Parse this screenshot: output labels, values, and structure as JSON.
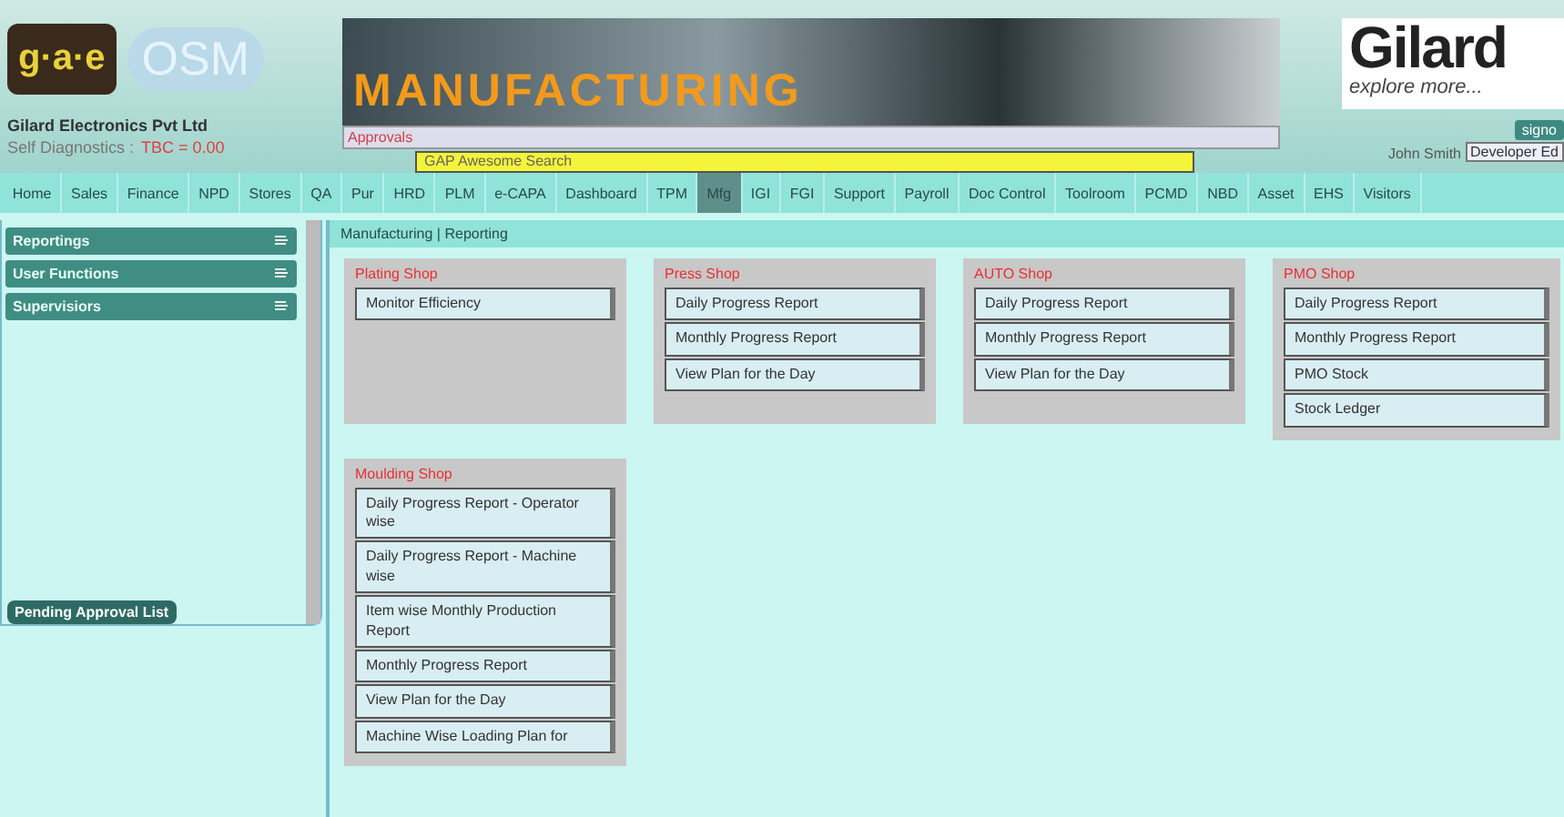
{
  "header": {
    "logo_text": "g·a·e",
    "logo_suffix": "OSM",
    "company": "Gilard Electronics Pvt Ltd",
    "diagnostics_label": "Self Diagnostics :",
    "diagnostics_value": "TBC = 0.00",
    "banner_title": "MANUFACTURING",
    "approvals": "Approvals",
    "search": {
      "placeholder": "GAP Awesome Search"
    },
    "brand": "Gilard",
    "tagline": "explore more...",
    "user": "John Smith",
    "signout": "signo",
    "edition": "Developer Ed"
  },
  "nav": [
    {
      "label": "Home",
      "selected": false
    },
    {
      "label": "Sales",
      "selected": false
    },
    {
      "label": "Finance",
      "selected": false
    },
    {
      "label": "NPD",
      "selected": false
    },
    {
      "label": "Stores",
      "selected": false
    },
    {
      "label": "QA",
      "selected": false
    },
    {
      "label": "Pur",
      "selected": false
    },
    {
      "label": "HRD",
      "selected": false
    },
    {
      "label": "PLM",
      "selected": false
    },
    {
      "label": "e-CAPA",
      "selected": false
    },
    {
      "label": "Dashboard",
      "selected": false
    },
    {
      "label": "TPM",
      "selected": false
    },
    {
      "label": "Mfg",
      "selected": true
    },
    {
      "label": "IGI",
      "selected": false
    },
    {
      "label": "FGI",
      "selected": false
    },
    {
      "label": "Support",
      "selected": false
    },
    {
      "label": "Payroll",
      "selected": false
    },
    {
      "label": "Doc Control",
      "selected": false
    },
    {
      "label": "Toolroom",
      "selected": false
    },
    {
      "label": "PCMD",
      "selected": false
    },
    {
      "label": "NBD",
      "selected": false
    },
    {
      "label": "Asset",
      "selected": false
    },
    {
      "label": "EHS",
      "selected": false
    },
    {
      "label": "Visitors",
      "selected": false
    }
  ],
  "sidebar": {
    "items": [
      "Reportings",
      "User Functions",
      "Supervisiors"
    ],
    "pending_button": "Pending Approval List"
  },
  "breadcrumb": "Manufacturing | Reporting",
  "shops": [
    {
      "title": "Plating Shop",
      "items": [
        "Monitor Efficiency"
      ]
    },
    {
      "title": "Press Shop",
      "items": [
        "Daily Progress Report",
        "Monthly Progress Report",
        "View Plan for the Day"
      ]
    },
    {
      "title": "AUTO Shop",
      "items": [
        "Daily Progress Report",
        "Monthly Progress Report",
        "View Plan for the Day"
      ]
    },
    {
      "title": "PMO Shop",
      "items": [
        "Daily Progress Report",
        "Monthly Progress Report",
        "PMO Stock",
        "Stock Ledger"
      ]
    },
    {
      "title": "Moulding Shop",
      "items": [
        "Daily Progress Report - Operator wise",
        "Daily Progress Report - Machine wise",
        "Item wise Monthly Production Report",
        "Monthly Progress Report",
        "View Plan for the Day",
        "Machine Wise Loading Plan for"
      ]
    }
  ]
}
